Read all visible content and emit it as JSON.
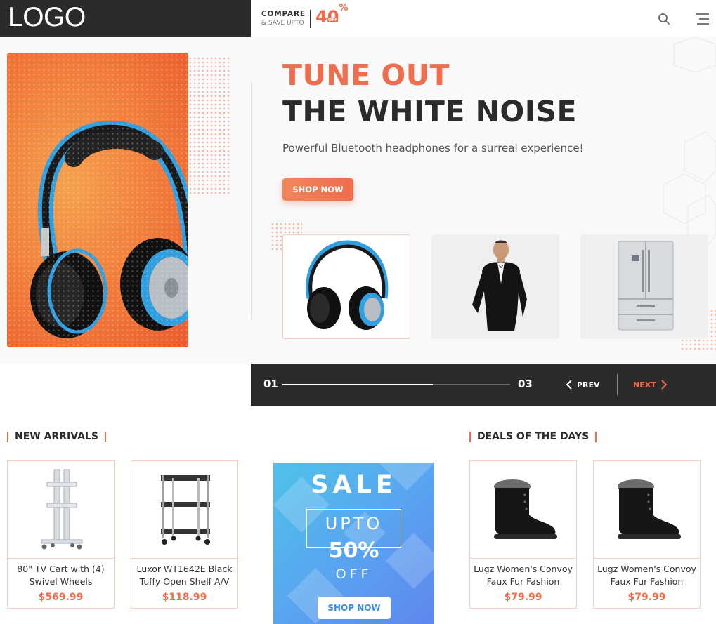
{
  "header": {
    "logo": "LOGO",
    "promo": {
      "line1": "COMPARE",
      "line2": "& SAVE UPTO",
      "percent_number": "40",
      "percent_sign": "%",
      "off": "OFF"
    },
    "icons": {
      "search": "search-icon",
      "menu": "menu-icon"
    }
  },
  "hero": {
    "title_line1": "TUNE OUT",
    "title_line2": "THE WHITE NOISE",
    "subtitle": "Powerful Bluetooth headphones for a surreal experience!",
    "cta": "SHOP NOW",
    "thumbnails": [
      {
        "id": "headphones",
        "alt": "headphones"
      },
      {
        "id": "man-in-tuxedo",
        "alt": "man in tuxedo"
      },
      {
        "id": "refrigerator",
        "alt": "refrigerator"
      }
    ]
  },
  "slider": {
    "current": "01",
    "total": "03",
    "progress": 0.66,
    "prev": "PREV",
    "next": "NEXT"
  },
  "new_arrivals": {
    "title": "NEW ARRIVALS",
    "items": [
      {
        "name": "80\" TV Cart with (4) Swivel Wheels",
        "price": "$569.99"
      },
      {
        "name": "Luxor WT1642E Black Tuffy Open Shelf A/V",
        "price": "$118.99"
      }
    ]
  },
  "sale_banner": {
    "sale": "SALE",
    "upto": "UPTO",
    "percent": "50%",
    "off": "OFF",
    "cta": "SHOP NOW"
  },
  "deals": {
    "title": "DEALS OF THE DAYS",
    "items": [
      {
        "name": "Lugz Women's Convoy Faux Fur Fashion",
        "price": "$79.99"
      },
      {
        "name": "Lugz Women's Convoy Faux Fur Fashion",
        "price": "$79.99"
      }
    ]
  },
  "colors": {
    "accent": "#ef6c4d",
    "dark": "#2b2b2b",
    "sale_blue": "#5a9ff0"
  }
}
